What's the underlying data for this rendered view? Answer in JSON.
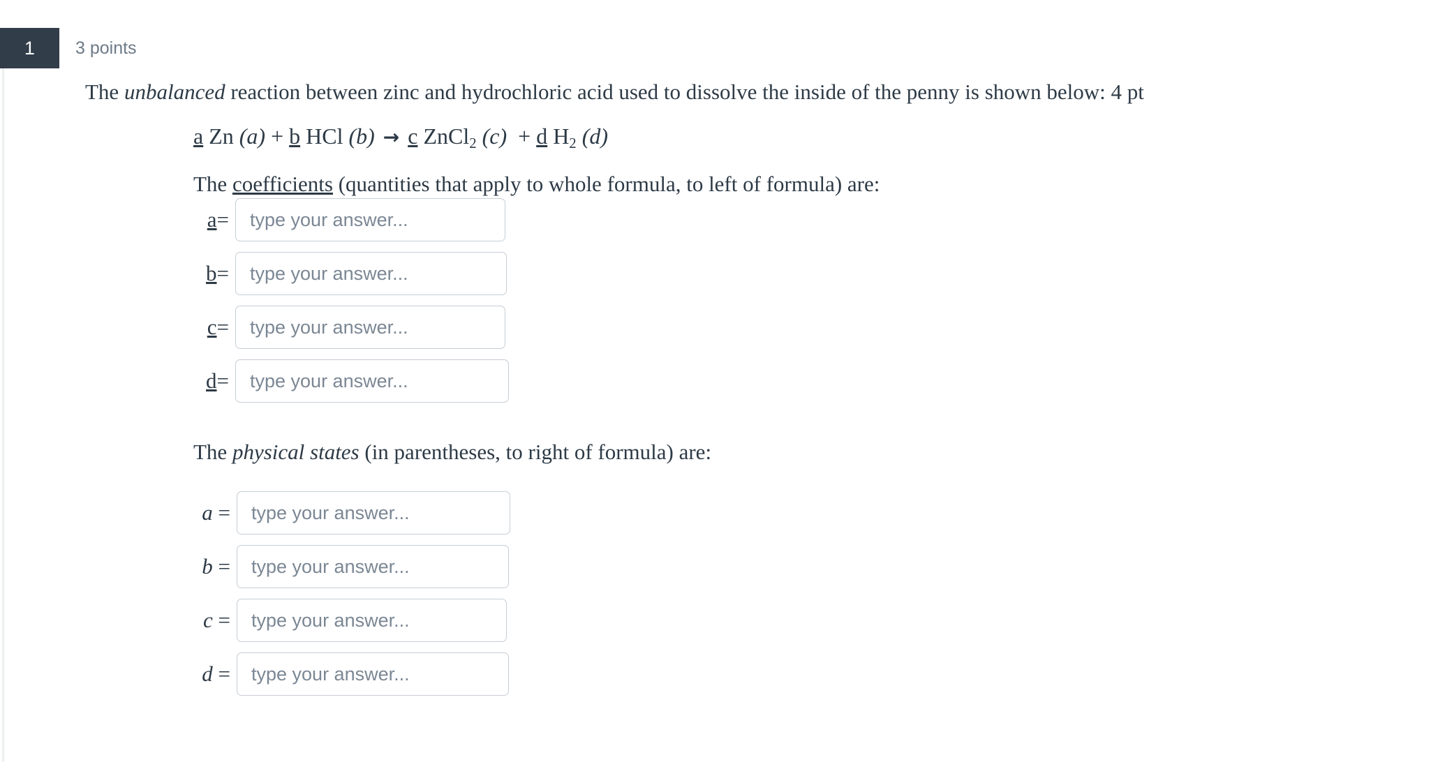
{
  "header": {
    "question_number": "1",
    "points": "3 points",
    "badge_color": "#313d49",
    "points_color": "#6d7a87"
  },
  "question": {
    "intro": {
      "before_italic": "The ",
      "italic": "unbalanced",
      "after_italic": " reaction between zinc and hydrochloric acid used to dissolve the inside of the penny is shown below: 4 pt"
    },
    "equation": {
      "coef_a": "a",
      "reactant_1": "Zn",
      "state_1": "(a)",
      "plus_1": "+",
      "coef_b": "b",
      "reactant_2": "HCl",
      "state_2": "(b)",
      "arrow": "→",
      "coef_c": "c",
      "product_1": "ZnCl",
      "product_1_sub": "2",
      "state_3": "(c)",
      "plus_2": "+",
      "coef_d": "d",
      "product_2": "H",
      "product_2_sub": "2",
      "state_4": "(d)"
    }
  },
  "coefficients_section": {
    "heading": {
      "before": "The ",
      "underlined": "coefficients",
      "after": " (quantities that apply to whole formula, to left of formula) are:"
    },
    "rows": [
      {
        "label": "a",
        "equals": "=",
        "placeholder": "type your answer...",
        "value": ""
      },
      {
        "label": "b",
        "equals": "=",
        "placeholder": "type your answer...",
        "value": ""
      },
      {
        "label": "c",
        "equals": "=",
        "placeholder": "type your answer...",
        "value": ""
      },
      {
        "label": "d",
        "equals": "=",
        "placeholder": "type your answer...",
        "value": ""
      }
    ]
  },
  "states_section": {
    "heading": {
      "before": "The ",
      "italic": "physical states",
      "after": " (in parentheses, to right of formula) are:"
    },
    "rows": [
      {
        "label": "a",
        "equals": "=",
        "placeholder": "type your answer...",
        "value": ""
      },
      {
        "label": "b",
        "equals": "=",
        "placeholder": "type your answer...",
        "value": ""
      },
      {
        "label": "c",
        "equals": "=",
        "placeholder": "type your answer...",
        "value": ""
      },
      {
        "label": "d",
        "equals": "=",
        "placeholder": "type your answer...",
        "value": ""
      }
    ]
  }
}
